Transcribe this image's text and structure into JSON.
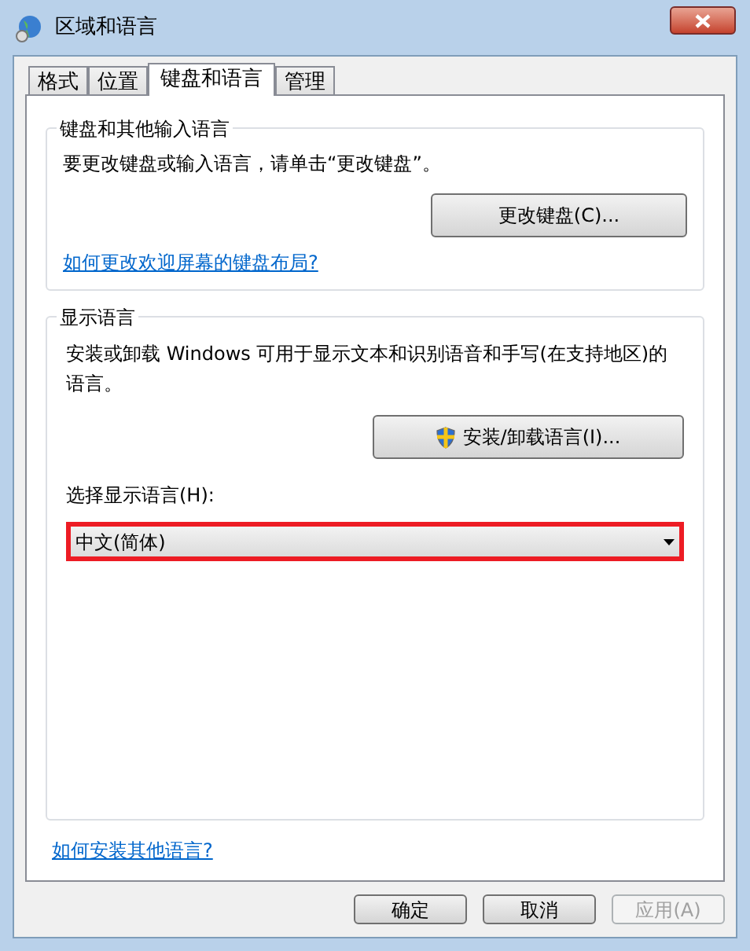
{
  "window": {
    "title": "区域和语言"
  },
  "tabs": [
    {
      "label": "格式",
      "selected": false
    },
    {
      "label": "位置",
      "selected": false
    },
    {
      "label": "键盘和语言",
      "selected": true
    },
    {
      "label": "管理",
      "selected": false
    }
  ],
  "keyboard_group": {
    "title": "键盘和其他输入语言",
    "text": "要更改键盘或输入语言，请单击“更改键盘”。",
    "button": "更改键盘(C)...",
    "link": "如何更改欢迎屏幕的键盘布局?"
  },
  "display_group": {
    "title": "显示语言",
    "text": "安装或卸载 Windows 可用于显示文本和识别语音和手写(在支持地区)的语言。",
    "button": "安装/卸载语言(I)...",
    "select_label": "选择显示语言(H):",
    "select_value": "中文(简体)",
    "highlighted": true
  },
  "link": "如何安装其他语言?",
  "buttons": [
    {
      "label": "确定",
      "disabled": false
    },
    {
      "label": "取消",
      "disabled": false
    },
    {
      "label": "应用(A)",
      "disabled": true
    }
  ]
}
